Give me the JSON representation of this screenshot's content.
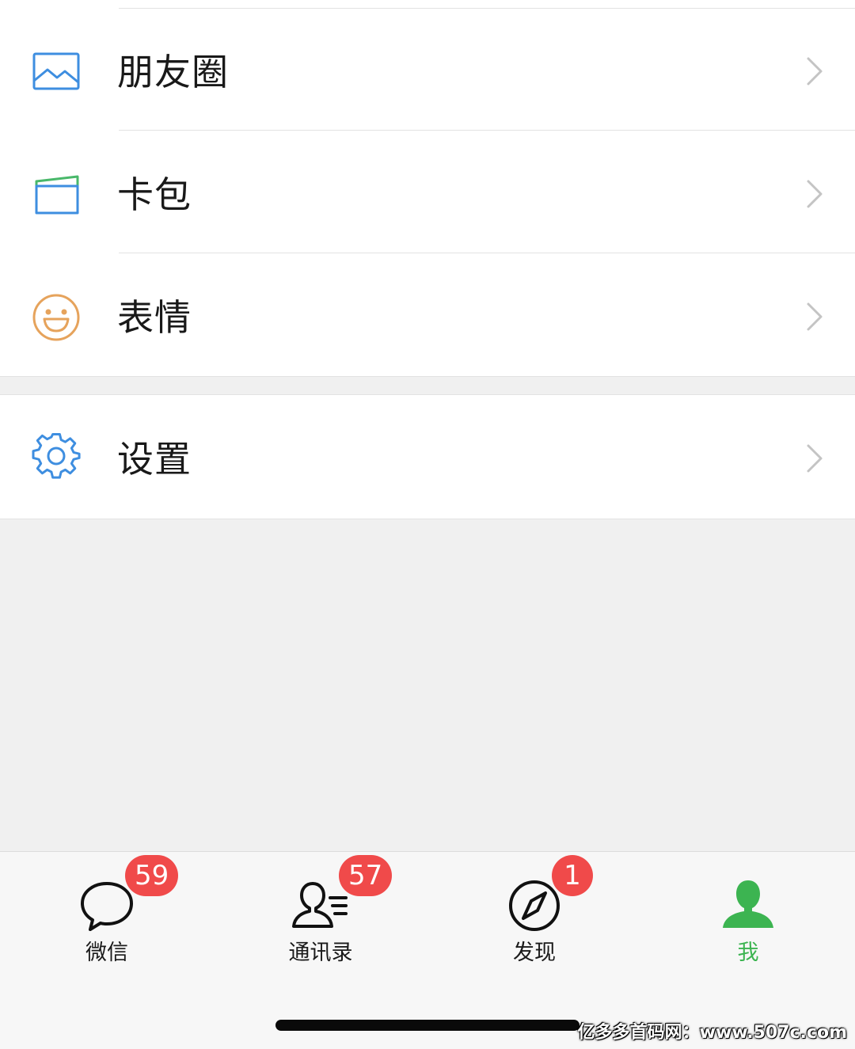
{
  "menu": {
    "group1": [
      {
        "label": "朋友圈",
        "icon": "moments-icon",
        "color": "#3e8ee0"
      },
      {
        "label": "卡包",
        "icon": "card-wallet-icon",
        "color": "#3e8ee0"
      },
      {
        "label": "表情",
        "icon": "smiley-icon",
        "color": "#e6a35c"
      }
    ],
    "group2": [
      {
        "label": "设置",
        "icon": "gear-icon",
        "color": "#3e8ee0"
      }
    ]
  },
  "tabbar": {
    "tabs": [
      {
        "label": "微信",
        "badge": "59",
        "icon": "chat-bubble-icon",
        "active": false
      },
      {
        "label": "通讯录",
        "badge": "57",
        "icon": "contacts-icon",
        "active": false
      },
      {
        "label": "发现",
        "badge": "1",
        "icon": "compass-icon",
        "active": false
      },
      {
        "label": "我",
        "badge": "",
        "icon": "person-icon",
        "active": true
      }
    ],
    "active_color": "#3cb451",
    "badge_color": "#f04a4a"
  },
  "watermark": "亿多多首码网：www.507c.com"
}
